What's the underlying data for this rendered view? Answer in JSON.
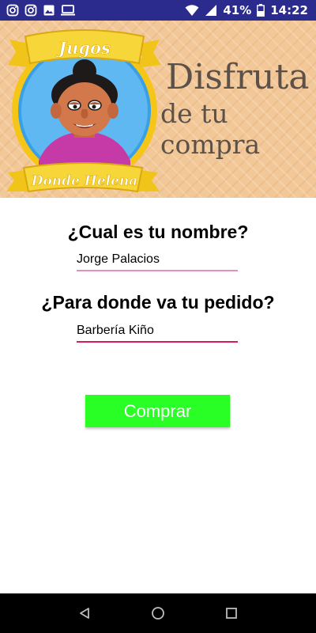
{
  "status_bar": {
    "battery": "41%",
    "time": "14:22",
    "icons": [
      "instagram-icon",
      "instagram-icon",
      "image-icon",
      "monitor-icon",
      "wifi-icon",
      "signal-icon",
      "battery-icon"
    ]
  },
  "banner": {
    "logo_top": "Jugos",
    "logo_bottom": "Donde Helena",
    "tagline_line1": "Disfruta",
    "tagline_line2": "de tu compra"
  },
  "form": {
    "name_question": "¿Cual es tu nombre?",
    "name_value": "Jorge Palacios",
    "destination_question": "¿Para donde va tu pedido?",
    "destination_value": "Barbería Kiño",
    "buy_label": "Comprar"
  },
  "nav": {
    "icons": [
      "back-icon",
      "home-icon",
      "recents-icon"
    ]
  },
  "colors": {
    "status_bar": "#2a2b8c",
    "button": "#29ff24",
    "underline_active": "#d81b60"
  }
}
